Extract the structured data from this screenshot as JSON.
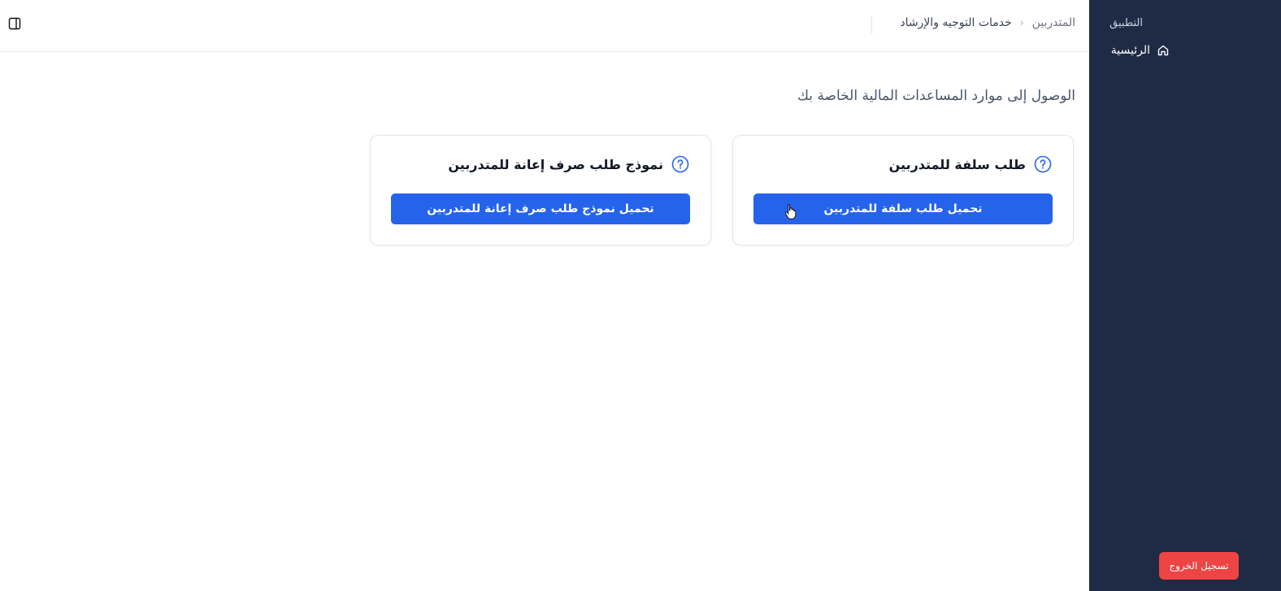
{
  "sidebar": {
    "section_label": "التطبيق",
    "items": [
      {
        "label": "الرئيسية",
        "icon": "home-icon"
      }
    ],
    "logout_label": "تسجيل الخروج",
    "background": "#1f2a44"
  },
  "header": {
    "breadcrumb": {
      "root": "المتدربين",
      "separator": "‹",
      "current": "خدمات التوجيه والإرشاد"
    },
    "toggle_icon": "sidebar-panel-icon"
  },
  "main": {
    "subtitle": "الوصول إلى موارد المساعدات المالية الخاصة بك",
    "cards": [
      {
        "title": "طلب سلفة للمتدربين",
        "button_label": "تحميل طلب سلفة للمتدربين",
        "icon": "help-circle-icon"
      },
      {
        "title": "نموذج طلب صرف إعانة للمتدربين",
        "button_label": "تحميل نموذج طلب صرف إعانة للمتدربين",
        "icon": "help-circle-icon"
      }
    ]
  },
  "colors": {
    "primary": "#2563eb",
    "danger": "#ef4444",
    "sidebar": "#1f2a44"
  }
}
